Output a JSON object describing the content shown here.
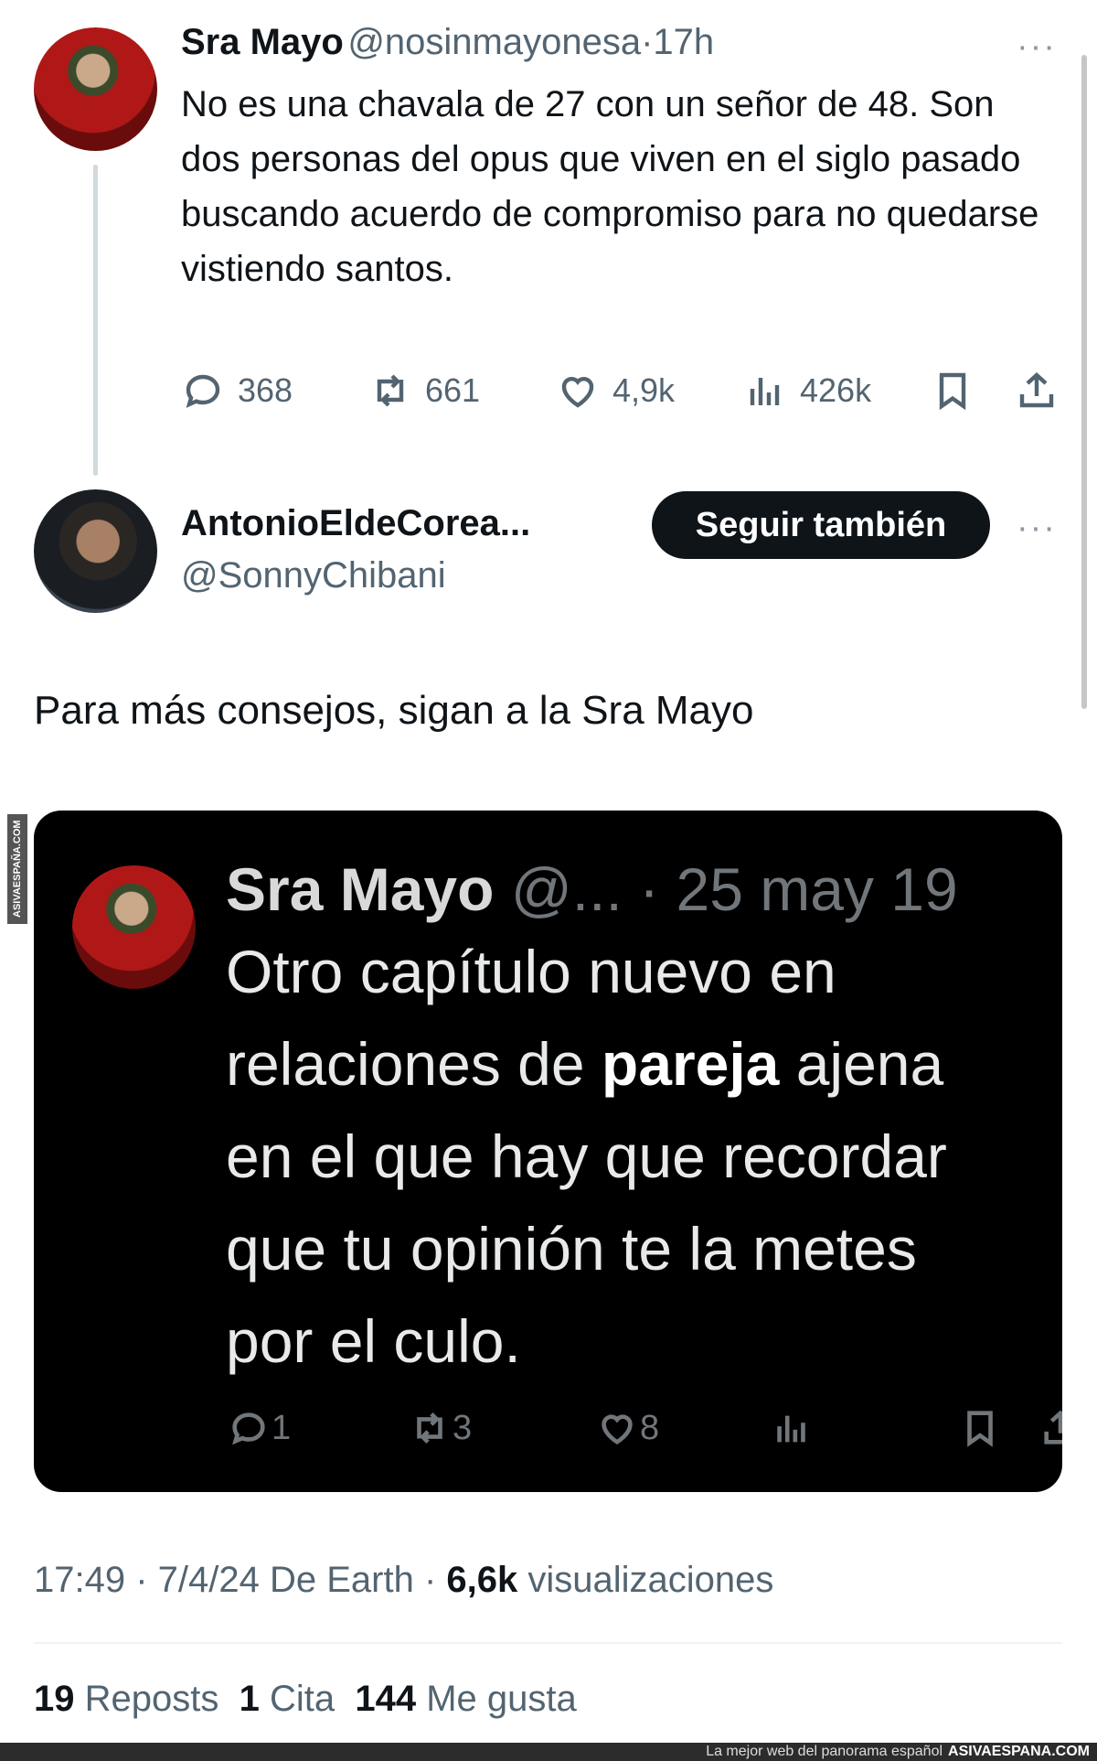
{
  "tweet": {
    "author_name": "Sra Mayo",
    "author_handle": "@nosinmayonesa",
    "separator": "·",
    "time": "17h",
    "more": "···",
    "text": "No es una chavala de 27 con un señor de 48. Son dos personas del opus que viven en el siglo pasado buscando acuerdo de compromiso para no quedarse vistiendo santos.",
    "actions": {
      "replies": "368",
      "reposts": "661",
      "likes": "4,9k",
      "views": "426k"
    }
  },
  "reply": {
    "author_name": "AntonioEldeCorea...",
    "author_handle": "@SonnyChibani",
    "follow_label": "Seguir también",
    "more": "···",
    "text": "Para más consejos, sigan a la Sra Mayo"
  },
  "quoted": {
    "author_name": "Sra Mayo",
    "author_handle": "@...",
    "date": "· 25 may 19",
    "lines": [
      "Otro capítulo nuevo en",
      "relaciones de ",
      "pareja",
      " ajena",
      "en el que hay que recordar",
      "que tu opinión te la metes",
      "por el culo."
    ],
    "actions": {
      "replies": "1",
      "reposts": "3",
      "likes": "8"
    }
  },
  "meta": {
    "time": "17:49",
    "date": "7/4/24",
    "source": "De Earth",
    "views_count": "6,6k",
    "views_label": "visualizaciones"
  },
  "stats": {
    "reposts_count": "19",
    "reposts_label": "Reposts",
    "quotes_count": "1",
    "quotes_label": "Cita",
    "likes_count": "144",
    "likes_label": "Me gusta"
  },
  "watermark": {
    "side": "ASIVAESPAÑA.COM",
    "footer_tagline": "La mejor web del panorama español",
    "footer_site": "ASIVAESPANA.COM"
  }
}
